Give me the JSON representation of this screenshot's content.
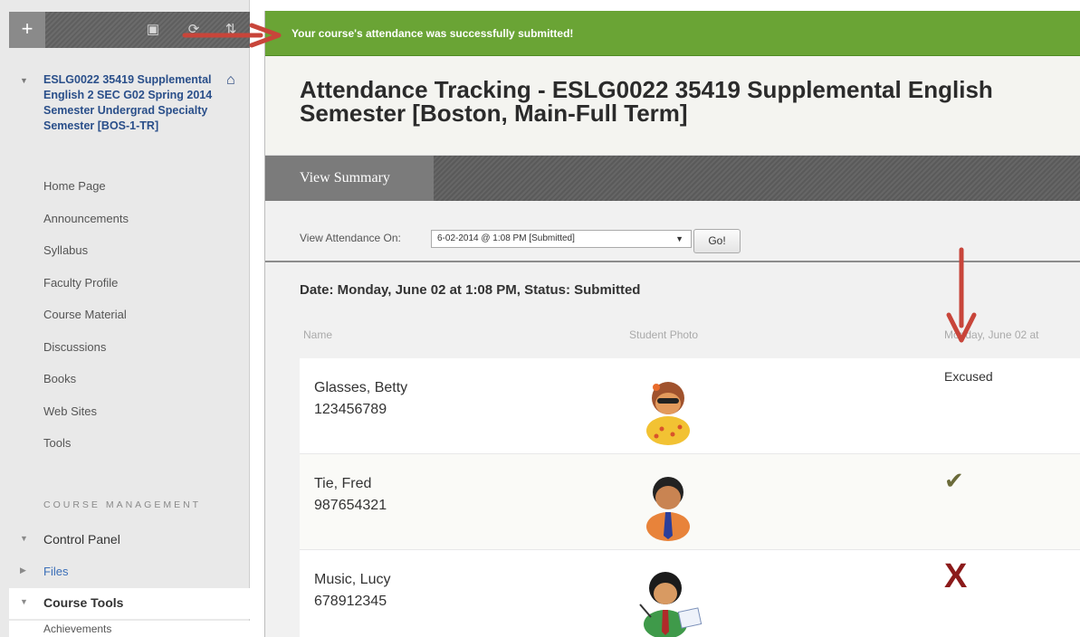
{
  "sidebar": {
    "toolbar": {
      "add_label": "+"
    },
    "course": {
      "title": "ESLG0022 35419 Supplemental English 2 SEC G02 Spring 2014 Semester Undergrad Specialty Semester [BOS-1-TR]"
    },
    "menu": [
      "Home Page",
      "Announcements",
      "Syllabus",
      "Faculty Profile",
      "Course Material",
      "Discussions",
      "Books",
      "Web Sites",
      "Tools"
    ],
    "management_label": "COURSE MANAGEMENT",
    "control_panel": "Control Panel",
    "files": "Files",
    "course_tools": "Course Tools",
    "achievements": "Achievements"
  },
  "main": {
    "success_message": "Your course's attendance was successfully submitted!",
    "page_title": "Attendance Tracking - ESLG0022 35419 Supplemental English Semester [Boston, Main-Full Term]",
    "tab_label": "View Summary",
    "view_on_label": "View Attendance On:",
    "selected_session": "6-02-2014 @ 1:08 PM [Submitted]",
    "go_label": "Go!",
    "date_status": "Date: Monday, June 02 at 1:08 PM, Status: Submitted",
    "columns": {
      "name": "Name",
      "photo": "Student Photo",
      "attendance": "Monday, June 02 at"
    },
    "students": [
      {
        "name": "Glasses, Betty",
        "id": "123456789",
        "status": "Excused",
        "status_icon": "text"
      },
      {
        "name": "Tie, Fred",
        "id": "987654321",
        "status": "present",
        "status_icon": "check-icon"
      },
      {
        "name": "Music, Lucy",
        "id": "678912345",
        "status": "absent",
        "status_icon": "x-icon"
      }
    ]
  },
  "colors": {
    "success_green": "#6aa435",
    "link_blue": "#2a4f8a",
    "arrow_red": "#c0392b",
    "absent_red": "#8b1a1a"
  }
}
